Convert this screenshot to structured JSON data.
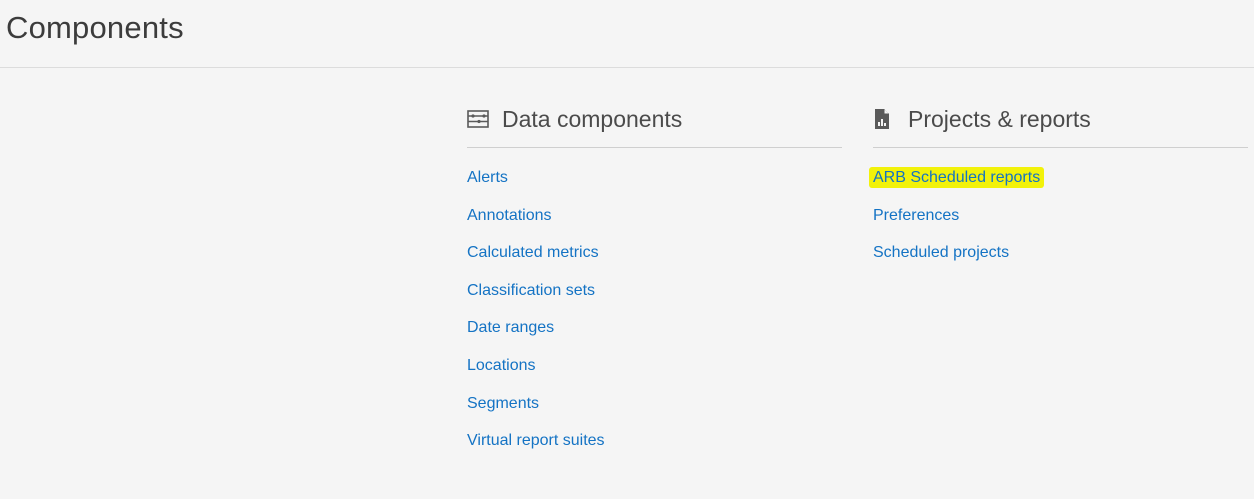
{
  "page": {
    "title": "Components"
  },
  "data_components": {
    "icon": "table-icon",
    "title": "Data components",
    "links": [
      "Alerts",
      "Annotations",
      "Calculated metrics",
      "Classification sets",
      "Date ranges",
      "Locations",
      "Segments",
      "Virtual report suites"
    ]
  },
  "projects_reports": {
    "icon": "document-icon",
    "title": "Projects & reports",
    "links": [
      "ARB Scheduled reports",
      "Preferences",
      "Scheduled projects"
    ],
    "highlight_color": "#f2f20a"
  },
  "colors": {
    "background": "#f5f5f5",
    "link": "#1473c4",
    "title": "#3c3c3c"
  }
}
